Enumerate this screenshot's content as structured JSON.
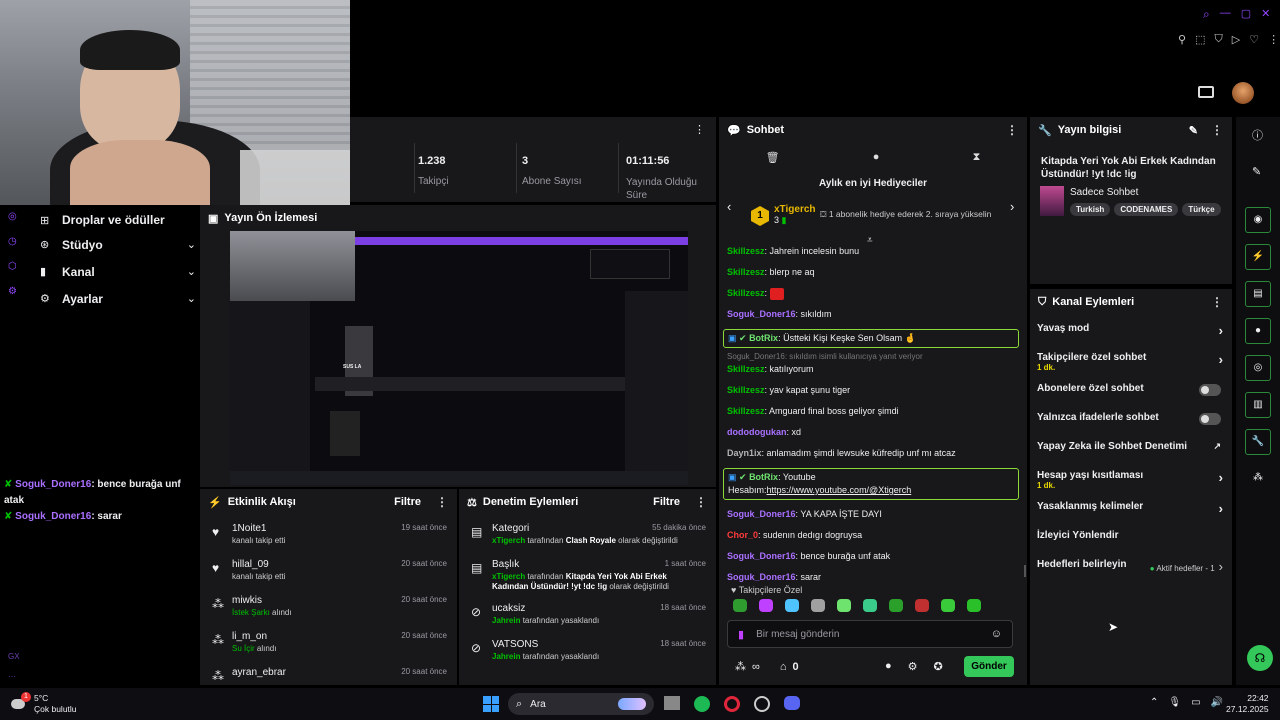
{
  "colors": {
    "accent": "#9147ff",
    "highlight": "#8cd93a",
    "send": "#34c759"
  },
  "stats": [
    {
      "value": "1.238",
      "label": "Takipçi"
    },
    {
      "value": "3",
      "label": "Abone Sayısı"
    },
    {
      "value": "01:11:56",
      "label_line1": "Yayında Olduğu",
      "label_line2": "Süre"
    }
  ],
  "sidebar": {
    "items": [
      {
        "label": "Droplar ve ödüller"
      },
      {
        "label": "Stüdyo"
      },
      {
        "label": "Kanal"
      },
      {
        "label": "Ayarlar"
      }
    ]
  },
  "overlay_chat": [
    {
      "user": "Soguk_Doner16",
      "text": ": bence burağa unf atak"
    },
    {
      "user": "Soguk_Doner16",
      "text": ": sarar"
    }
  ],
  "preview": {
    "title": "Yayın Ön İzlemesi",
    "embedded_label": "SUS LA"
  },
  "activity": {
    "title": "Etkinlik Akışı",
    "filter": "Filtre",
    "items": [
      {
        "name": "1Noite1",
        "time": "19 saat önce",
        "detail": "kanalı takip etti",
        "icon": "heart-icon"
      },
      {
        "name": "hillal_09",
        "time": "20 saat önce",
        "detail": "kanalı takip etti",
        "icon": "heart-icon"
      },
      {
        "name": "miwkis",
        "time": "20 saat önce",
        "detail_green": "İstek Şarkı",
        "detail": " alındı",
        "icon": "points-icon"
      },
      {
        "name": "li_m_on",
        "time": "20 saat önce",
        "detail_green": "Su İçir",
        "detail": " alındı",
        "icon": "points-icon"
      },
      {
        "name": "ayran_ebrar",
        "time": "20 saat önce",
        "detail": "",
        "icon": "points-icon"
      }
    ]
  },
  "moderation": {
    "title": "Denetim Eylemleri",
    "filter": "Filtre",
    "items": [
      {
        "title": "Kategori",
        "time": "55 dakika önce",
        "actor": "xTigerch",
        "mid": " tarafından ",
        "target": "Clash Royale",
        "end": " olarak değiştirildi",
        "extra": ""
      },
      {
        "title": "Başlık",
        "time": "1 saat önce",
        "actor": "xTigerch",
        "mid": " tarafından ",
        "target": "Kitapda Yeri Yok Abi Erkek",
        "extra": "Kadından Üstündür! !yt !dc !ig",
        "end": " olarak değiştirildi"
      },
      {
        "title": "ucaksiz",
        "time": "18 saat önce",
        "actor": "Jahrein",
        "mid": " tarafından yasaklandı",
        "target": "",
        "end": "",
        "extra": ""
      },
      {
        "title": "VATSONS",
        "time": "18 saat önce",
        "actor": "Jahrein",
        "mid": " tarafından yasaklandı",
        "target": "",
        "end": "",
        "extra": ""
      }
    ]
  },
  "chat": {
    "title": "Sohbet",
    "gifters_title": "Aylık en iyi Hediyeciler",
    "gifter_name": "xTigerch",
    "gifter_count": "3",
    "gifter_rank": "1",
    "gifter_text": "1 abonelik hediye ederek 2. sıraya yükselin",
    "messages": [
      {
        "user": "Skillzesz",
        "color": "#00c000",
        "text": ": Jahrein incelesin bunu"
      },
      {
        "user": "Skillzesz",
        "color": "#00c000",
        "text": ": blerp ne aq"
      },
      {
        "user": "Skillzesz",
        "color": "#00c000",
        "text": ": ",
        "emote": true
      },
      {
        "user": "Soguk_Doner16",
        "color": "#a970ff",
        "text": ": sıkıldım"
      },
      {
        "user": "BotRix",
        "color": "#6ee36e",
        "text": ": Üstteki Kişi Keşke Sen Olsam 🤞",
        "boxed": true
      },
      {
        "reply": "Soguk_Doner16: sıkıldım isimli kullanıcıya yanıt veriyor",
        "user": "Skillzesz",
        "color": "#00c000",
        "text": ": katılıyorum"
      },
      {
        "user": "Skillzesz",
        "color": "#00c000",
        "text": ": yav kapat şunu tiger"
      },
      {
        "user": "Skillzesz",
        "color": "#00c000",
        "text": ": Amguard final boss geliyor şimdi"
      },
      {
        "user": "dododogukan",
        "color": "#a970ff",
        "text": ": xd"
      },
      {
        "user": "Dayn1ix",
        "color": "#b4b4b4",
        "text": ": anlamadım şimdi lewsuke küfredip unf mı atcaz"
      },
      {
        "user": "BotRix",
        "color": "#6ee36e",
        "text": ": Youtube",
        "boxed": true,
        "line2": "Hesabım:",
        "link": "https://www.youtube.com/@Xtigerch"
      },
      {
        "user": "Soguk_Doner16",
        "color": "#a970ff",
        "text": ": YA KAPA İŞTE DAYI"
      },
      {
        "user": "Chor_0",
        "color": "#ff3a3a",
        "text": ": sudenın dedıgı dogruysa"
      },
      {
        "user": "Soguk_Doner16",
        "color": "#a970ff",
        "text": ": bence burağa unf atak"
      },
      {
        "user": "Soguk_Doner16",
        "color": "#a970ff",
        "text": ": sarar"
      }
    ],
    "emote_section": "Takipçilere Özel",
    "input_placeholder": "Bir mesaj gönderin",
    "points": "0",
    "send": "Gönder"
  },
  "stream_info": {
    "header": "Yayın bilgisi",
    "title_line1": "Kitapda Yeri Yok Abi Erkek Kadından",
    "title_line2": "Üstündür! !yt !dc !ig",
    "category": "Sadece Sohbet",
    "tags": [
      "Turkish",
      "CODENAMES",
      "Türkçe"
    ]
  },
  "channel_actions": {
    "header": "Kanal Eylemleri",
    "items": [
      {
        "label": "Yavaş mod",
        "type": "chevron"
      },
      {
        "label": "Takipçilere özel sohbet",
        "sub": "1 dk.",
        "type": "chevron"
      },
      {
        "label": "Abonelere özel sohbet",
        "type": "toggle"
      },
      {
        "label": "Yalnızca ifadelerle sohbet",
        "type": "toggle"
      },
      {
        "label": "Yapay Zeka ile Sohbet Denetimi",
        "type": "external"
      },
      {
        "label": "Hesap yaşı kısıtlaması",
        "sub": "1 dk.",
        "type": "chevron"
      },
      {
        "label": "Yasaklanmış kelimeler",
        "type": "chevron"
      },
      {
        "label": "İzleyici Yönlendir",
        "type": "none"
      },
      {
        "label": "Hedefleri belirleyin",
        "type": "goal",
        "extra": "Aktif hedefler - 1"
      }
    ]
  },
  "taskbar": {
    "temp": "5°C",
    "weather": "Çok bulutlu",
    "search": "Ara",
    "time": "22:42",
    "date": "27.12.2025",
    "badge": "1"
  },
  "misc": {
    "gx": "GX"
  }
}
